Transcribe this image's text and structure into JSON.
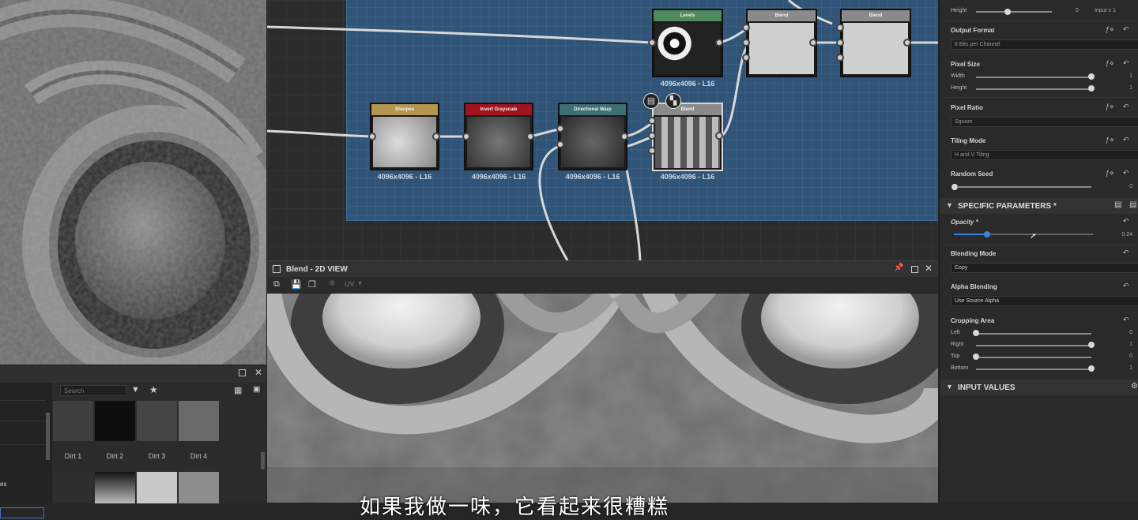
{
  "viewport3d": {},
  "library": {
    "search_placeholder": "Search",
    "partial_text": "es",
    "thumbnails": [
      {
        "label": "Dirt 1",
        "color": "#3c3c3c"
      },
      {
        "label": "Dirt 2",
        "color": "#0f0f0f"
      },
      {
        "label": "Dirt 3",
        "color": "#4a4a4a"
      },
      {
        "label": "Dirt 4",
        "color": "#7a7a7a"
      }
    ]
  },
  "graph": {
    "nodes": [
      {
        "id": "levels",
        "title": "Levels",
        "header_color": "#4f8a5d",
        "resolution": "4096x4096 - L16"
      },
      {
        "id": "blend-top-1",
        "title": "Blend",
        "header_color": "#8a8a8a",
        "resolution": ""
      },
      {
        "id": "blend-top-2",
        "title": "Blend",
        "header_color": "#8a8a8a",
        "resolution": ""
      },
      {
        "id": "sharpen",
        "title": "Sharpen",
        "header_color": "#b5964f",
        "resolution": "4096x4096 - L16"
      },
      {
        "id": "invert-grayscale",
        "title": "Invert Grayscale",
        "header_color": "#a0141e",
        "resolution": "4096x4096 - L16"
      },
      {
        "id": "directional-warp",
        "title": "Directional Warp",
        "header_color": "#3e6f74",
        "resolution": "4096x4096 - L16"
      },
      {
        "id": "blend-selected",
        "title": "Blend",
        "header_color": "#8a8a8a",
        "resolution": "4096x4096 - L16"
      }
    ]
  },
  "view2d": {
    "title": "Blend - 2D VIEW",
    "uv_label": "UV"
  },
  "properties": {
    "top_rows": [
      {
        "label": "Height",
        "value": "0",
        "extra": "Input x 1"
      }
    ],
    "output_format": {
      "label": "Output Format",
      "value": "8 Bits per Channel"
    },
    "pixel_size": {
      "label": "Pixel Size",
      "width_label": "Width",
      "width_value": "1",
      "height_label": "Height",
      "height_value": "1"
    },
    "pixel_ratio": {
      "label": "Pixel Ratio",
      "value": "Square"
    },
    "tiling_mode": {
      "label": "Tiling Mode",
      "value": "H and V Tiling"
    },
    "random_seed": {
      "label": "Random Seed",
      "value": "0"
    },
    "specific_section": "SPECIFIC PARAMETERS *",
    "opacity": {
      "label": "Opacity *",
      "value": "0.24",
      "level": 0.24
    },
    "blending_mode": {
      "label": "Blending Mode",
      "value": "Copy"
    },
    "alpha_blending": {
      "label": "Alpha Blending",
      "value": "Use Source Alpha"
    },
    "cropping": {
      "label": "Cropping Area",
      "rows": [
        {
          "label": "Left",
          "value": "0",
          "level": 0
        },
        {
          "label": "Right",
          "value": "1",
          "level": 1
        },
        {
          "label": "Top",
          "value": "0",
          "level": 0
        },
        {
          "label": "Bottom",
          "value": "1",
          "level": 1
        }
      ]
    },
    "input_section": "INPUT VALUES"
  },
  "subtitle": "如果我做一味，它看起来很糟糕"
}
